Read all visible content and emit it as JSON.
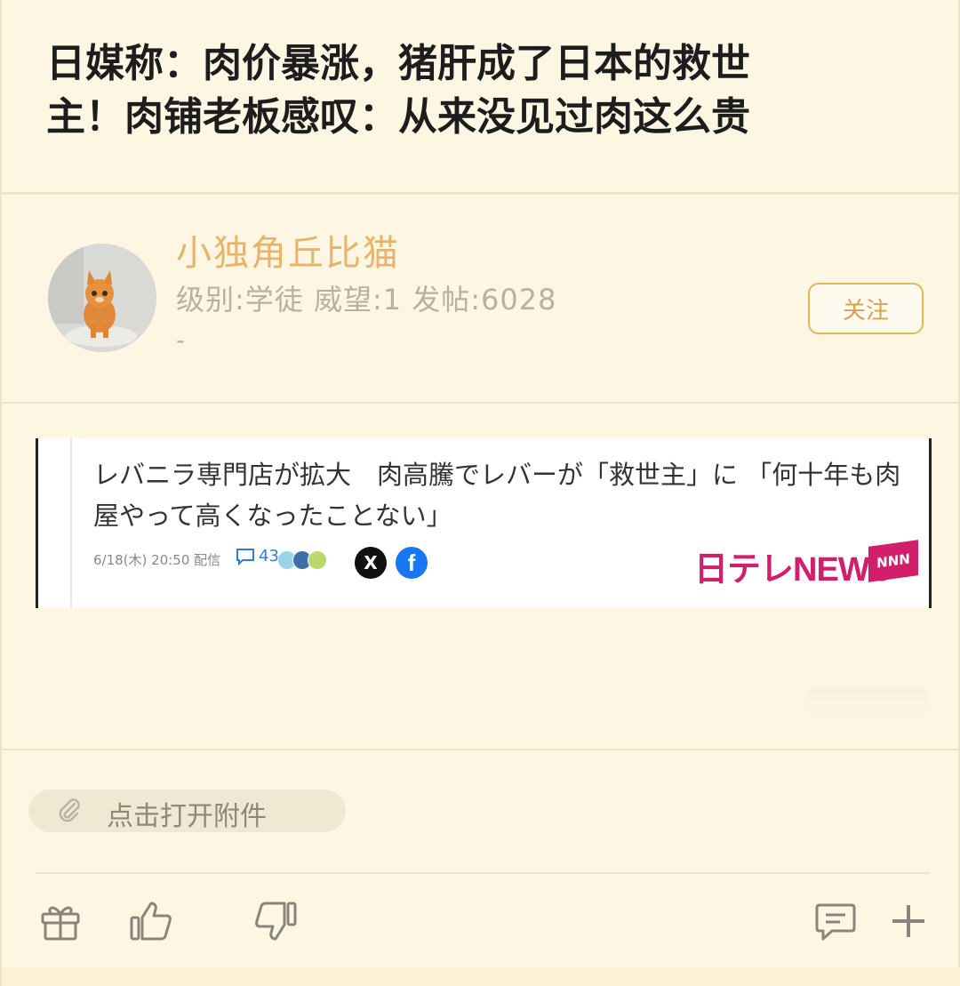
{
  "post": {
    "title_line1": "日媒称：肉价暴涨，猪肝成了日本的救世",
    "title_line2": "主！肉铺老板感叹：从来没见过肉这么贵"
  },
  "author": {
    "name": "小独角丘比猫",
    "meta": "级别:学徒 威望:1 发帖:6028",
    "signature": "-",
    "follow_label": "关注"
  },
  "embed": {
    "headline": "レバニラ専門店が拡大　肉高騰でレバーが「救世主」に 「何十年も肉屋やって高くなったことない」",
    "date": "6/18(木) 20:50 配信",
    "comment_count": "43",
    "brand": "日テレNEWS",
    "brand_badge": "NNN"
  },
  "attachment": {
    "label": "点击打开附件"
  },
  "actions": [
    "gift-icon",
    "like-icon",
    "dislike-icon",
    "comment-icon",
    "plus-icon"
  ]
}
